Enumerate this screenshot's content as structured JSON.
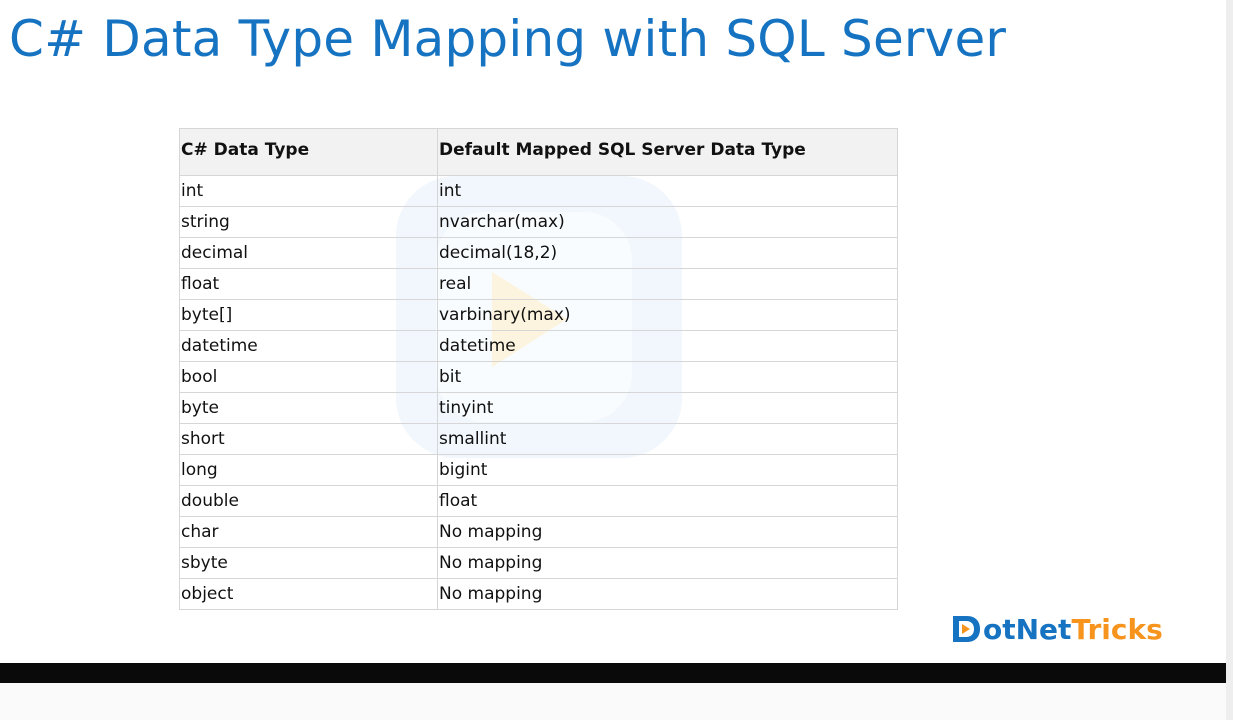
{
  "slide": {
    "title": "C# Data Type Mapping with SQL Server"
  },
  "table": {
    "headers": [
      "C# Data Type",
      "Default Mapped SQL Server Data Type"
    ],
    "rows": [
      [
        "int",
        "int"
      ],
      [
        "string",
        "nvarchar(max)"
      ],
      [
        "decimal",
        "decimal(18,2)"
      ],
      [
        "float",
        "real"
      ],
      [
        "byte[]",
        "varbinary(max)"
      ],
      [
        "datetime",
        "datetime"
      ],
      [
        "bool",
        "bit"
      ],
      [
        "byte",
        "tinyint"
      ],
      [
        "short",
        "smallint"
      ],
      [
        "long",
        "bigint"
      ],
      [
        "double",
        "float"
      ],
      [
        "char",
        "No mapping"
      ],
      [
        "sbyte",
        "No mapping"
      ],
      [
        "object",
        "No mapping"
      ]
    ]
  },
  "logo": {
    "text_part1": "otNet",
    "text_part2": "Tricks",
    "icon": "play-d-logo-icon"
  },
  "colors": {
    "title": "#1573c1",
    "brand_blue": "#1573c1",
    "brand_orange": "#f7941d",
    "header_bg": "#f2f2f2",
    "grid": "#d6d6d6"
  }
}
